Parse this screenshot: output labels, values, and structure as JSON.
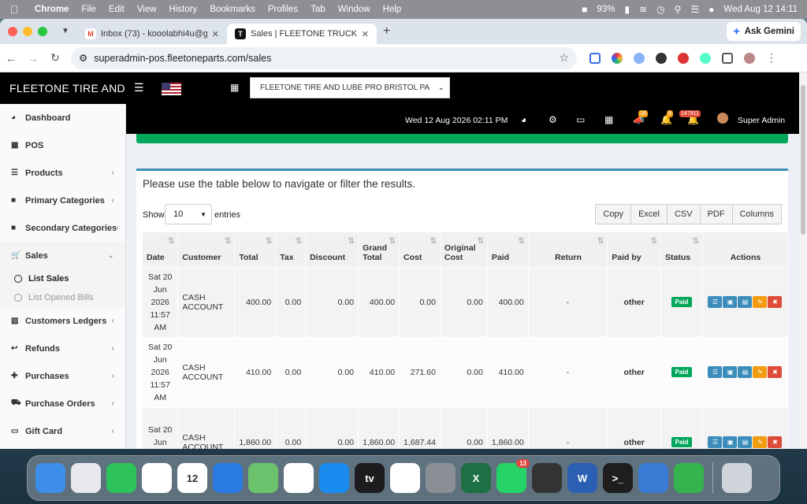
{
  "menubar": {
    "app": "Chrome",
    "items": [
      "File",
      "Edit",
      "View",
      "History",
      "Bookmarks",
      "Profiles",
      "Tab",
      "Window",
      "Help"
    ],
    "battery": "93%",
    "clock": "Wed Aug 12  14:11"
  },
  "browser": {
    "tabs": [
      {
        "title": "Inbox (73) - kooolabhi4u@gm",
        "active": false
      },
      {
        "title": "Sales | FLEETONE  TRUCK &",
        "active": true
      }
    ],
    "ask_gemini": "Ask Gemini",
    "url": "superadmin-pos.fleetoneparts.com/sales"
  },
  "topnav": {
    "brand": "FLEETONE TIRE AND",
    "store": "FLEETONE TIRE AND LUBE PRO BRISTOL PA",
    "datetime": "Wed 12 Aug 2026 02:11 PM",
    "badges": {
      "megaphone": "18",
      "bell": "8",
      "alerts": "147911"
    },
    "user": "Super Admin"
  },
  "sidebar": {
    "items": [
      {
        "label": "Dashboard",
        "icon": "dashboard-icon",
        "arrow": false
      },
      {
        "label": "POS",
        "icon": "grid-icon",
        "arrow": false
      },
      {
        "label": "Products",
        "icon": "barcode-icon",
        "arrow": true
      },
      {
        "label": "Primary Categories",
        "icon": "folder-icon",
        "arrow": true
      },
      {
        "label": "Secondary Categories",
        "icon": "folder-icon",
        "arrow": true
      },
      {
        "label": "Sales",
        "icon": "cart-icon",
        "arrow": true,
        "open": true
      }
    ],
    "sub": [
      "List Sales",
      "List Opened Bills"
    ],
    "items2": [
      {
        "label": "Customers Ledgers",
        "icon": "book-icon"
      },
      {
        "label": "Refunds",
        "icon": "reply-icon"
      },
      {
        "label": "Purchases",
        "icon": "plus-icon"
      },
      {
        "label": "Purchase Orders",
        "icon": "truck-icon"
      },
      {
        "label": "Gift Card",
        "icon": "card-icon"
      }
    ]
  },
  "main": {
    "intro": "Please use the table below to navigate or filter the results.",
    "show_label": "Show",
    "page_length": "10",
    "entries_label": "entries",
    "export_buttons": [
      "Copy",
      "Excel",
      "CSV",
      "PDF",
      "Columns"
    ],
    "columns": [
      [
        "Date"
      ],
      [
        "Customer"
      ],
      [
        "Total"
      ],
      [
        "Tax"
      ],
      [
        "Discount"
      ],
      [
        "Grand",
        "Total"
      ],
      [
        "Cost"
      ],
      [
        "Original",
        "Cost"
      ],
      [
        "Paid"
      ],
      [
        "Return"
      ],
      [
        "Paid by"
      ],
      [
        "Status"
      ],
      [
        "Actions"
      ]
    ],
    "rows": [
      {
        "date": [
          "Sat 20",
          "Jun",
          "2026",
          "11:57",
          "AM"
        ],
        "customer": [
          "CASH",
          "ACCOUNT"
        ],
        "total": "400.00",
        "tax": "0.00",
        "discount": "0.00",
        "grand_total": "400.00",
        "cost": "0.00",
        "original_cost": "0.00",
        "paid": "400.00",
        "return": "-",
        "paid_by": "other",
        "status": "Paid"
      },
      {
        "date": [
          "Sat 20",
          "Jun",
          "2026",
          "11:57",
          "AM"
        ],
        "customer": [
          "CASH",
          "ACCOUNT"
        ],
        "total": "410.00",
        "tax": "0.00",
        "discount": "0.00",
        "grand_total": "410.00",
        "cost": "271.60",
        "original_cost": "0.00",
        "paid": "410.00",
        "return": "-",
        "paid_by": "other",
        "status": "Paid"
      },
      {
        "date": [
          "Sat 20",
          "Jun",
          "2026"
        ],
        "customer": [
          "CASH",
          "ACCOUNT"
        ],
        "total": "1,860.00",
        "tax": "0.00",
        "discount": "0.00",
        "grand_total": "1,860.00",
        "cost": "1,687.44",
        "original_cost": "0.00",
        "paid": "1,860.00",
        "return": "-",
        "paid_by": "other",
        "status": "Paid"
      }
    ]
  },
  "dock": {
    "apps": [
      {
        "name": "finder-icon",
        "color": "#3d8ee8",
        "label": ""
      },
      {
        "name": "launchpad-icon",
        "color": "#e8e8ee",
        "label": ""
      },
      {
        "name": "facetime-icon",
        "color": "#2ec35a",
        "label": ""
      },
      {
        "name": "chrome-icon",
        "color": "#ffffff",
        "label": ""
      },
      {
        "name": "calendar-icon",
        "color": "#ffffff",
        "label": "12"
      },
      {
        "name": "keynote-icon",
        "color": "#2a7be4",
        "label": ""
      },
      {
        "name": "maps-icon",
        "color": "#6bc46d",
        "label": ""
      },
      {
        "name": "photos-icon",
        "color": "#ffffff",
        "label": ""
      },
      {
        "name": "appstore-icon",
        "color": "#1a8cf0",
        "label": ""
      },
      {
        "name": "appletv-icon",
        "color": "#1c1c1e",
        "label": "tv"
      },
      {
        "name": "reminders-icon",
        "color": "#ffffff",
        "label": ""
      },
      {
        "name": "preview-icon",
        "color": "#8a8f96",
        "label": ""
      },
      {
        "name": "excel-icon",
        "color": "#1d7044",
        "label": "X"
      },
      {
        "name": "whatsapp-icon",
        "color": "#25d366",
        "label": "",
        "badge": "13"
      },
      {
        "name": "box-app-icon",
        "color": "#333333",
        "label": ""
      },
      {
        "name": "word-icon",
        "color": "#2b5fb4",
        "label": "W"
      },
      {
        "name": "terminal-icon",
        "color": "#1e1e1e",
        "label": ">_"
      },
      {
        "name": "simulator-icon",
        "color": "#3a7bd5",
        "label": ""
      },
      {
        "name": "numbers-icon",
        "color": "#34b34f",
        "label": ""
      },
      {
        "name": "trash-icon",
        "color": "#cfd4da",
        "label": ""
      }
    ]
  },
  "colors": {
    "accent": "#3c8dbc",
    "success": "#00a65a",
    "danger": "#dd4b39",
    "warning": "#f39c12"
  }
}
